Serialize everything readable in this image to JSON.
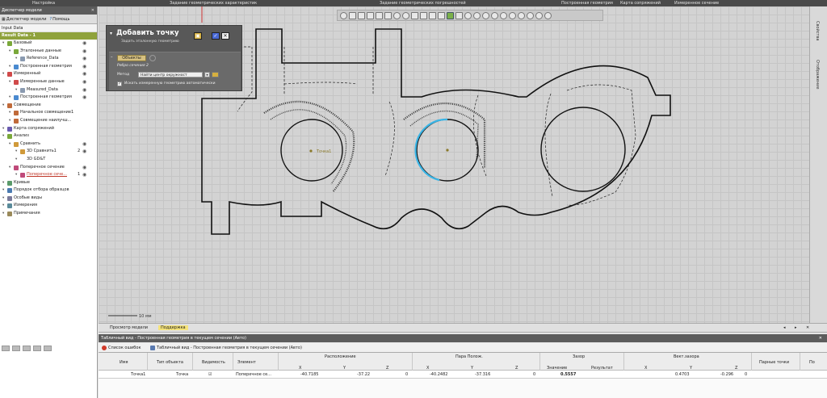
{
  "menubar": {
    "items": [
      "Настройка",
      "Задание геометрических характеристик",
      "Задание геометрических погрешностей",
      "Построенная геометрия",
      "Карта сопряжений",
      "Измеренное сечение"
    ]
  },
  "model_panel": {
    "title": "Диспетчер модели",
    "tabs": [
      "Диспетчер модели",
      "Помощь"
    ],
    "input_label": "Input Data",
    "result_label": "Result Data - 1",
    "tree": [
      {
        "label": "Базовый",
        "indent": 0,
        "icon": "green",
        "eye": true
      },
      {
        "label": "Эталонные данные",
        "indent": 1,
        "icon": "green",
        "eye": true
      },
      {
        "label": "Reference_Data",
        "indent": 2,
        "icon": "doc",
        "eye": true
      },
      {
        "label": "Построенная геометрия",
        "indent": 1,
        "icon": "geom",
        "eye": true
      },
      {
        "label": "Измеренный",
        "indent": 0,
        "icon": "red",
        "eye": true
      },
      {
        "label": "Измеренные данные",
        "indent": 1,
        "icon": "red",
        "eye": true
      },
      {
        "label": "Measured_Data",
        "indent": 2,
        "icon": "doc",
        "eye": true
      },
      {
        "label": "Построенная геометрия",
        "indent": 1,
        "icon": "geom",
        "eye": true
      },
      {
        "label": "Совмещение",
        "indent": 0,
        "icon": "align",
        "eye": false
      },
      {
        "label": "Начальное совмещение1",
        "indent": 1,
        "icon": "align",
        "eye": false
      },
      {
        "label": "Совмещение наилучш...",
        "indent": 1,
        "icon": "align",
        "eye": false
      },
      {
        "label": "Карта сопряжений",
        "indent": 0,
        "icon": "map",
        "eye": false
      },
      {
        "label": "Анализ",
        "indent": 0,
        "icon": "green",
        "eye": false
      },
      {
        "label": "Сравнить",
        "indent": 1,
        "icon": "cmp",
        "eye": true
      },
      {
        "label": "3D Сравнить1",
        "indent": 2,
        "icon": "cmp",
        "eye": true,
        "num": "2"
      },
      {
        "label": "3D GD&T",
        "indent": 2,
        "icon": "none",
        "eye": false
      },
      {
        "label": "Поперечное сечение",
        "indent": 1,
        "icon": "sec",
        "eye": true
      },
      {
        "label": "Поперечное сече...",
        "indent": 2,
        "icon": "sec",
        "eye": true,
        "num": "1",
        "active": true
      },
      {
        "label": "Кривые",
        "indent": 0,
        "icon": "curve",
        "eye": false
      },
      {
        "label": "Порядок отбора образцов",
        "indent": 0,
        "icon": "order",
        "eye": false
      },
      {
        "label": "Особые виды",
        "indent": 0,
        "icon": "view",
        "eye": false
      },
      {
        "label": "Измерения",
        "indent": 0,
        "icon": "meas",
        "eye": false
      },
      {
        "label": "Примечания",
        "indent": 0,
        "icon": "note",
        "eye": false
      }
    ]
  },
  "dialog": {
    "title": "Добавить точку",
    "subtitle": "Задать эталонную геометрию",
    "objects_tag": "Объекты",
    "field_edge": "Ребро сечения 2",
    "method_label": "Метод",
    "method_value": "Найти центр окружност",
    "auto_label": "Искать измеренную геометрию автоматически"
  },
  "viewport": {
    "point_label": "Точка1",
    "scale_label": "10 мм"
  },
  "right_panel": [
    "Свойства",
    "Отображение"
  ],
  "bottom_tabs": [
    "Просмотр модели",
    "Поддержка"
  ],
  "table_view": {
    "title": "Табличный вид - Построенная геометрия в текущем сечении (Авто)",
    "tabs": [
      "Список ошибок",
      "Табличный вид - Построенная геометрия в текущем сечении (Авто)"
    ],
    "groups": [
      "Расположение",
      "Пара Полож.",
      "Зазор",
      "Вект.зазора"
    ],
    "columns": [
      "Имя",
      "Тип объекта",
      "Видимость",
      "Элемент",
      "X",
      "Y",
      "Z",
      "X",
      "Y",
      "Z",
      "Значение",
      "Результат",
      "X",
      "Y",
      "Z",
      "Парные точки",
      "По"
    ],
    "row": [
      "Точка1",
      "Точка",
      "☑",
      "Поперечное се...",
      "-40.7185",
      "-37.22",
      "0",
      "-40.2482",
      "-37.316",
      "0",
      "0.5557",
      "",
      "0.4703",
      "-0.296",
      "0",
      "",
      ""
    ]
  },
  "colors": {
    "dialog_bg": "#585858",
    "result_bar": "#8fa23c",
    "highlight_arc": "#3ab5e6",
    "accent_tab": "#f5e37a"
  }
}
